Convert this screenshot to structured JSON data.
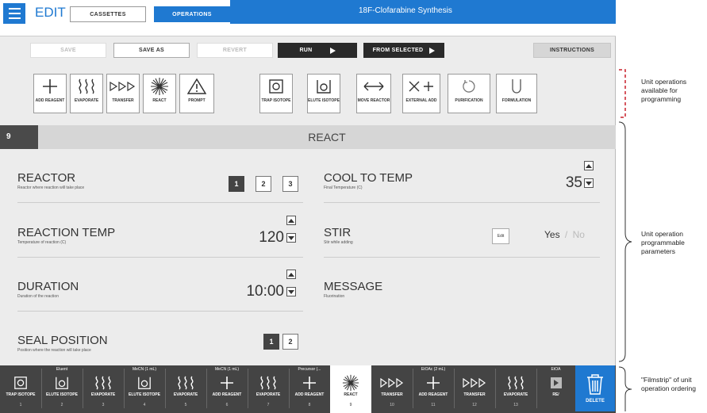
{
  "header": {
    "edit_title": "EDIT",
    "tabs": [
      {
        "label": "CASSETTES"
      },
      {
        "label": "OPERATIONS"
      }
    ],
    "sequence_title": "18F-Clofarabine Synthesis"
  },
  "toolbar": {
    "save": "SAVE",
    "save_as": "SAVE AS",
    "revert": "REVERT",
    "run": "RUN",
    "from_selected": "FROM SELECTED",
    "instructions": "INSTRUCTIONS"
  },
  "palette": [
    {
      "label": "ADD REAGENT",
      "icon": "plus-icon"
    },
    {
      "label": "EVAPORATE",
      "icon": "evaporate-icon"
    },
    {
      "label": "TRANSFER",
      "icon": "transfer-icon"
    },
    {
      "label": "REACT",
      "icon": "react-icon"
    },
    {
      "label": "PROMPT",
      "icon": "warning-icon"
    },
    {
      "label": "TRAP ISOTOPE",
      "icon": "trap-isotope-icon"
    },
    {
      "label": "ELUTE ISOTOPE",
      "icon": "elute-isotope-icon"
    },
    {
      "label": "MOVE REACTOR",
      "icon": "move-reactor-icon"
    },
    {
      "label": "EXTERNAL ADD",
      "icon": "external-add-icon"
    },
    {
      "label": "PURIFICATION",
      "icon": "purification-icon"
    },
    {
      "label": "FORMULATION",
      "icon": "formulation-icon"
    }
  ],
  "operation": {
    "number": "9",
    "name": "REACT"
  },
  "params": {
    "reactor": {
      "name": "REACTOR",
      "desc": "Reactor where reaction will take place",
      "options": [
        "1",
        "2",
        "3"
      ],
      "selected": "1"
    },
    "cool_to_temp": {
      "name": "COOL TO TEMP",
      "desc": "Final Temperature (C)",
      "value": "35"
    },
    "reaction_temp": {
      "name": "REACTION TEMP",
      "desc": "Temperature of reaction (C)",
      "value": "120"
    },
    "stir": {
      "name": "STIR",
      "desc": "Stir while adding",
      "edit": "Edit",
      "yes": "Yes",
      "sep": "/",
      "no": "No",
      "selected": "Yes"
    },
    "duration": {
      "name": "DURATION",
      "desc": "Duration of the reaction",
      "value": "10:00"
    },
    "message": {
      "name": "MESSAGE",
      "desc": "Fluorination"
    },
    "seal_position": {
      "name": "SEAL POSITION",
      "desc": "Position where the reaction will take place",
      "options": [
        "1",
        "2"
      ],
      "selected": "1"
    }
  },
  "filmstrip": [
    {
      "top": "",
      "label": "TRAP ISOTOPE",
      "num": "1",
      "icon": "trap-isotope-icon"
    },
    {
      "top": "Eluent",
      "label": "ELUTE ISOTOPE",
      "num": "2",
      "icon": "elute-isotope-icon"
    },
    {
      "top": "",
      "label": "EVAPORATE",
      "num": "3",
      "icon": "evaporate-icon"
    },
    {
      "top": "MeCN (1 mL)",
      "label": "ELUTE ISOTOPE",
      "num": "4",
      "icon": "elute-isotope-icon"
    },
    {
      "top": "",
      "label": "EVAPORATE",
      "num": "5",
      "icon": "evaporate-icon"
    },
    {
      "top": "MeCN (1 mL)",
      "label": "ADD REAGENT",
      "num": "6",
      "icon": "plus-icon"
    },
    {
      "top": "",
      "label": "EVAPORATE",
      "num": "7",
      "icon": "evaporate-icon"
    },
    {
      "top": "Precursor (...",
      "label": "ADD REAGENT",
      "num": "8",
      "icon": "plus-icon"
    },
    {
      "top": "",
      "label": "REACT",
      "num": "9",
      "icon": "react-icon",
      "active": true
    },
    {
      "top": "",
      "label": "TRANSFER",
      "num": "10",
      "icon": "transfer-icon"
    },
    {
      "top": "EtOAc (2 mL)",
      "label": "ADD REAGENT",
      "num": "11",
      "icon": "plus-icon"
    },
    {
      "top": "",
      "label": "TRANSFER",
      "num": "12",
      "icon": "transfer-icon"
    },
    {
      "top": "",
      "label": "EVAPORATE",
      "num": "13",
      "icon": "evaporate-icon"
    },
    {
      "top": "EtOA",
      "label": "RE/",
      "num": "",
      "icon": "play-icon"
    }
  ],
  "delete_label": "DELETE",
  "annotations": {
    "palette_note": "Unit operations available for programming",
    "params_note": "Unit operation programmable parameters",
    "filmstrip_note": "\"Filmstrip\" of unit operation ordering"
  },
  "colors": {
    "accent": "#1f79d1",
    "dashed": "#c9202b",
    "dark": "#444444"
  }
}
